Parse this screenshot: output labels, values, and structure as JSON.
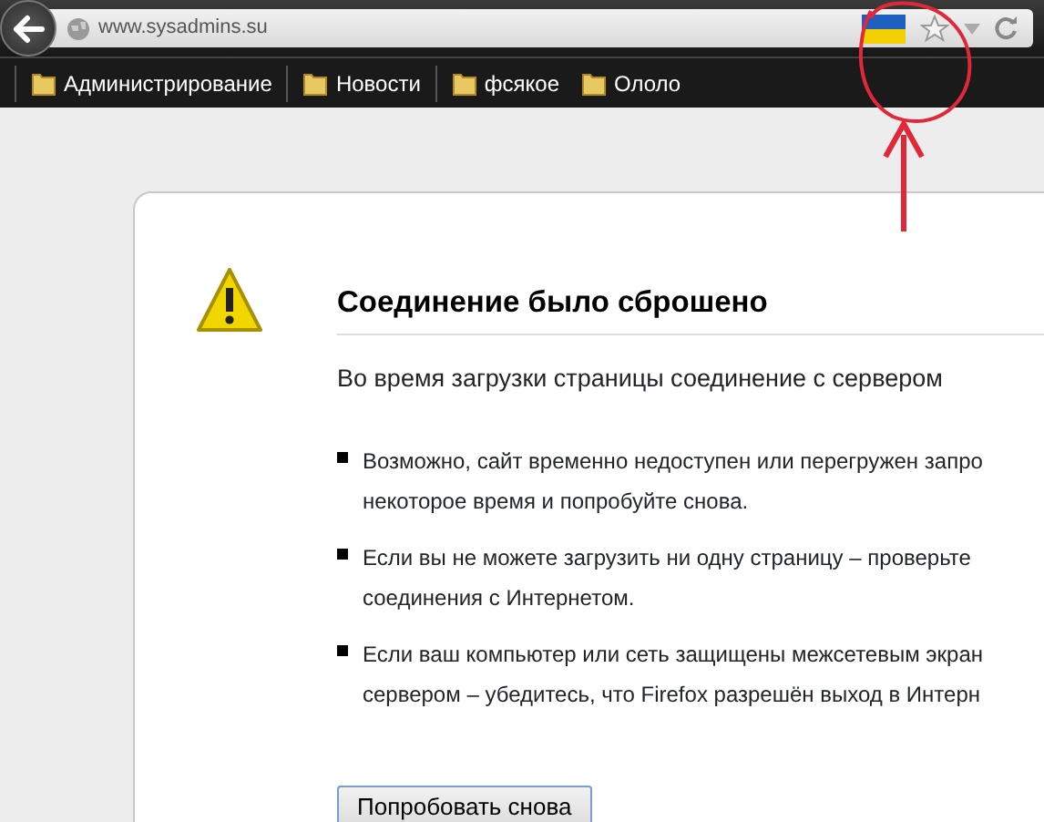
{
  "address_bar": {
    "url": "www.sysadmins.su"
  },
  "bookmarks": [
    {
      "label": "Администрирование",
      "separator_after": true
    },
    {
      "label": "Новости",
      "separator_after": true
    },
    {
      "label": "фсякое",
      "separator_after": false
    },
    {
      "label": "Ололо",
      "separator_after": false
    }
  ],
  "error_page": {
    "title": "Соединение было сброшено",
    "description": "Во время загрузки страницы соединение с сервером",
    "suggestions": [
      {
        "lines": [
          "Возможно, сайт временно недоступен или перегружен запро",
          "некоторое время и попробуйте снова."
        ]
      },
      {
        "lines": [
          "Если вы не можете загрузить ни одну страницу – проверьте",
          "соединения с Интернетом."
        ]
      },
      {
        "lines": [
          "Если ваш компьютер или сеть защищены межсетевым экран",
          "сервером – убедитесь, что Firefox разрешён выход в Интерн"
        ]
      }
    ],
    "button": "Попробовать снова"
  }
}
